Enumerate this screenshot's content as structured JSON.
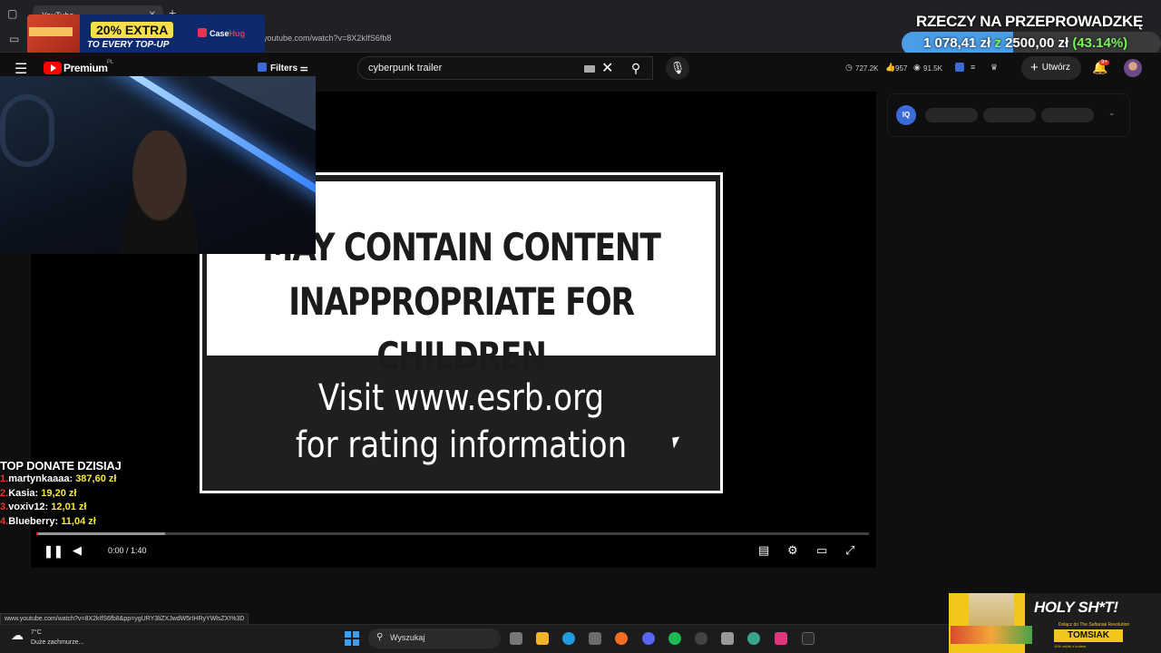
{
  "browser": {
    "tab_title": "YouTube",
    "url": "youtube.com/watch?v=8X2kIfS6fb8",
    "status_url": "www.youtube.com/watch?v=8X2kIfS6fb8&pp=ygURY3liZXJwdW5rIHRyYWlsZXI%3D"
  },
  "promo": {
    "headline": "20% EXTRA",
    "subline": "TO EVERY TOP-UP",
    "brand_a": "Case",
    "brand_b": "Hug"
  },
  "goal": {
    "title": "RZECZY NA PRZEPROWADZKĘ",
    "current": "1 078,41 zł",
    "connector": "z",
    "target": "2500,00 zł",
    "percent_text": "(43.14%)",
    "progress_fraction": 0.4314,
    "fill_color": "#4a9de6"
  },
  "youtube": {
    "brand": "Premium",
    "region": "PL",
    "filters_label": "Filters",
    "search_value": "cyberpunk trailer",
    "stats": {
      "views": "727.2K",
      "likes": "957",
      "subs": "91.5K"
    },
    "create_label": "Utwórz",
    "notif_badge": "9+"
  },
  "player": {
    "warning_line1": "MAY CONTAIN CONTENT",
    "warning_line2": "INAPPROPRIATE FOR CHILDREN",
    "visit_line1": "Visit www.esrb.org",
    "visit_line2": "for rating information",
    "time": "0:00 / 1:40",
    "progress_fraction": 0.0,
    "buffered_fraction": 0.155
  },
  "right_panel": {
    "iq_label": "IQ"
  },
  "donate": {
    "heading": "TOP DONATE DZISIAJ",
    "entries": [
      {
        "rank": "1.",
        "name": "martynkaaaa:",
        "amount": "387,60 zł"
      },
      {
        "rank": "2.",
        "name": "Kasia:",
        "amount": "19,20 zł"
      },
      {
        "rank": "3.",
        "name": "voxiv12:",
        "amount": "12,01 zł"
      },
      {
        "rank": "4.",
        "name": "Blueberry:",
        "amount": "11,04 zł"
      }
    ]
  },
  "taskbar": {
    "temp": "7°C",
    "weather": "Duże zachmurze...",
    "search_label": "Wyszukaj"
  },
  "ad": {
    "headline": "HOLY SH*T!",
    "small": "Dołącz do The Saftariak Revolution",
    "name": "TOMSIAK",
    "tagline": "10% zniżki z kodem"
  }
}
